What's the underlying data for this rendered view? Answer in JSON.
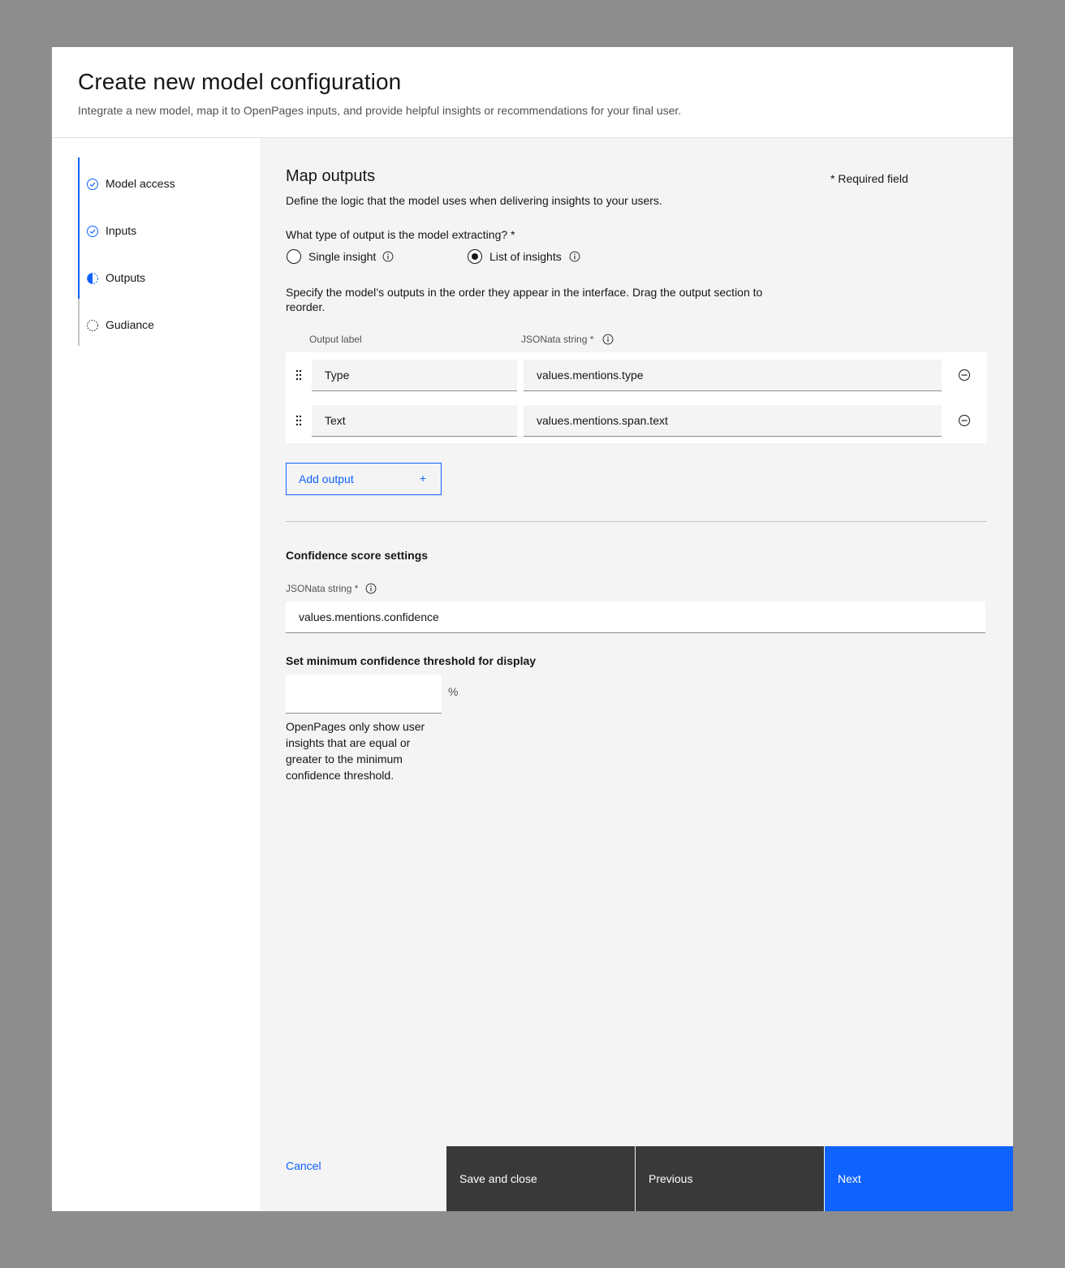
{
  "header": {
    "title": "Create new model configuration",
    "subtitle": "Integrate a new model, map it to OpenPages inputs, and provide helpful insights or recommendations for your final user."
  },
  "steps": [
    {
      "label": "Model access",
      "state": "complete",
      "icon": "checkmark-outline-icon"
    },
    {
      "label": "Inputs",
      "state": "complete",
      "icon": "checkmark-outline-icon"
    },
    {
      "label": "Outputs",
      "state": "current",
      "icon": "incomplete-half-icon"
    },
    {
      "label": "Gudiance",
      "state": "incomplete",
      "icon": "circle-dash-icon"
    }
  ],
  "main": {
    "heading": "Map outputs",
    "required_note": "* Required field",
    "description": "Define the logic that the model uses when delivering insights to your users.",
    "output_type": {
      "question": "What type of output is the model extracting? *",
      "options": [
        {
          "label": "Single insight",
          "checked": false
        },
        {
          "label": "List of insights",
          "checked": true
        }
      ]
    },
    "order_instruction": "Specify the model’s outputs in the order they appear in the interface. Drag the output section to reorder.",
    "columns": {
      "label": "Output label",
      "jsonata": "JSONata string *"
    },
    "outputs": [
      {
        "label": "Type",
        "jsonata": "values.mentions.type"
      },
      {
        "label": "Text",
        "jsonata": "values.mentions.span.text"
      }
    ],
    "add_output_label": "Add output",
    "confidence": {
      "heading": "Confidence score settings",
      "jsonata_label": "JSONata string *",
      "jsonata_value": "values.mentions.confidence",
      "threshold_heading": "Set minimum confidence threshold for display",
      "threshold_value": "",
      "threshold_unit": "%",
      "helper_text": "OpenPages only show user insights that are equal or greater to the minimum confidence threshold."
    }
  },
  "footer": {
    "cancel": "Cancel",
    "save_close": "Save and close",
    "previous": "Previous",
    "next": "Next"
  },
  "colors": {
    "accent": "#0f62fe",
    "secondary_button": "#393939",
    "overlay": "#8d8d8d"
  }
}
